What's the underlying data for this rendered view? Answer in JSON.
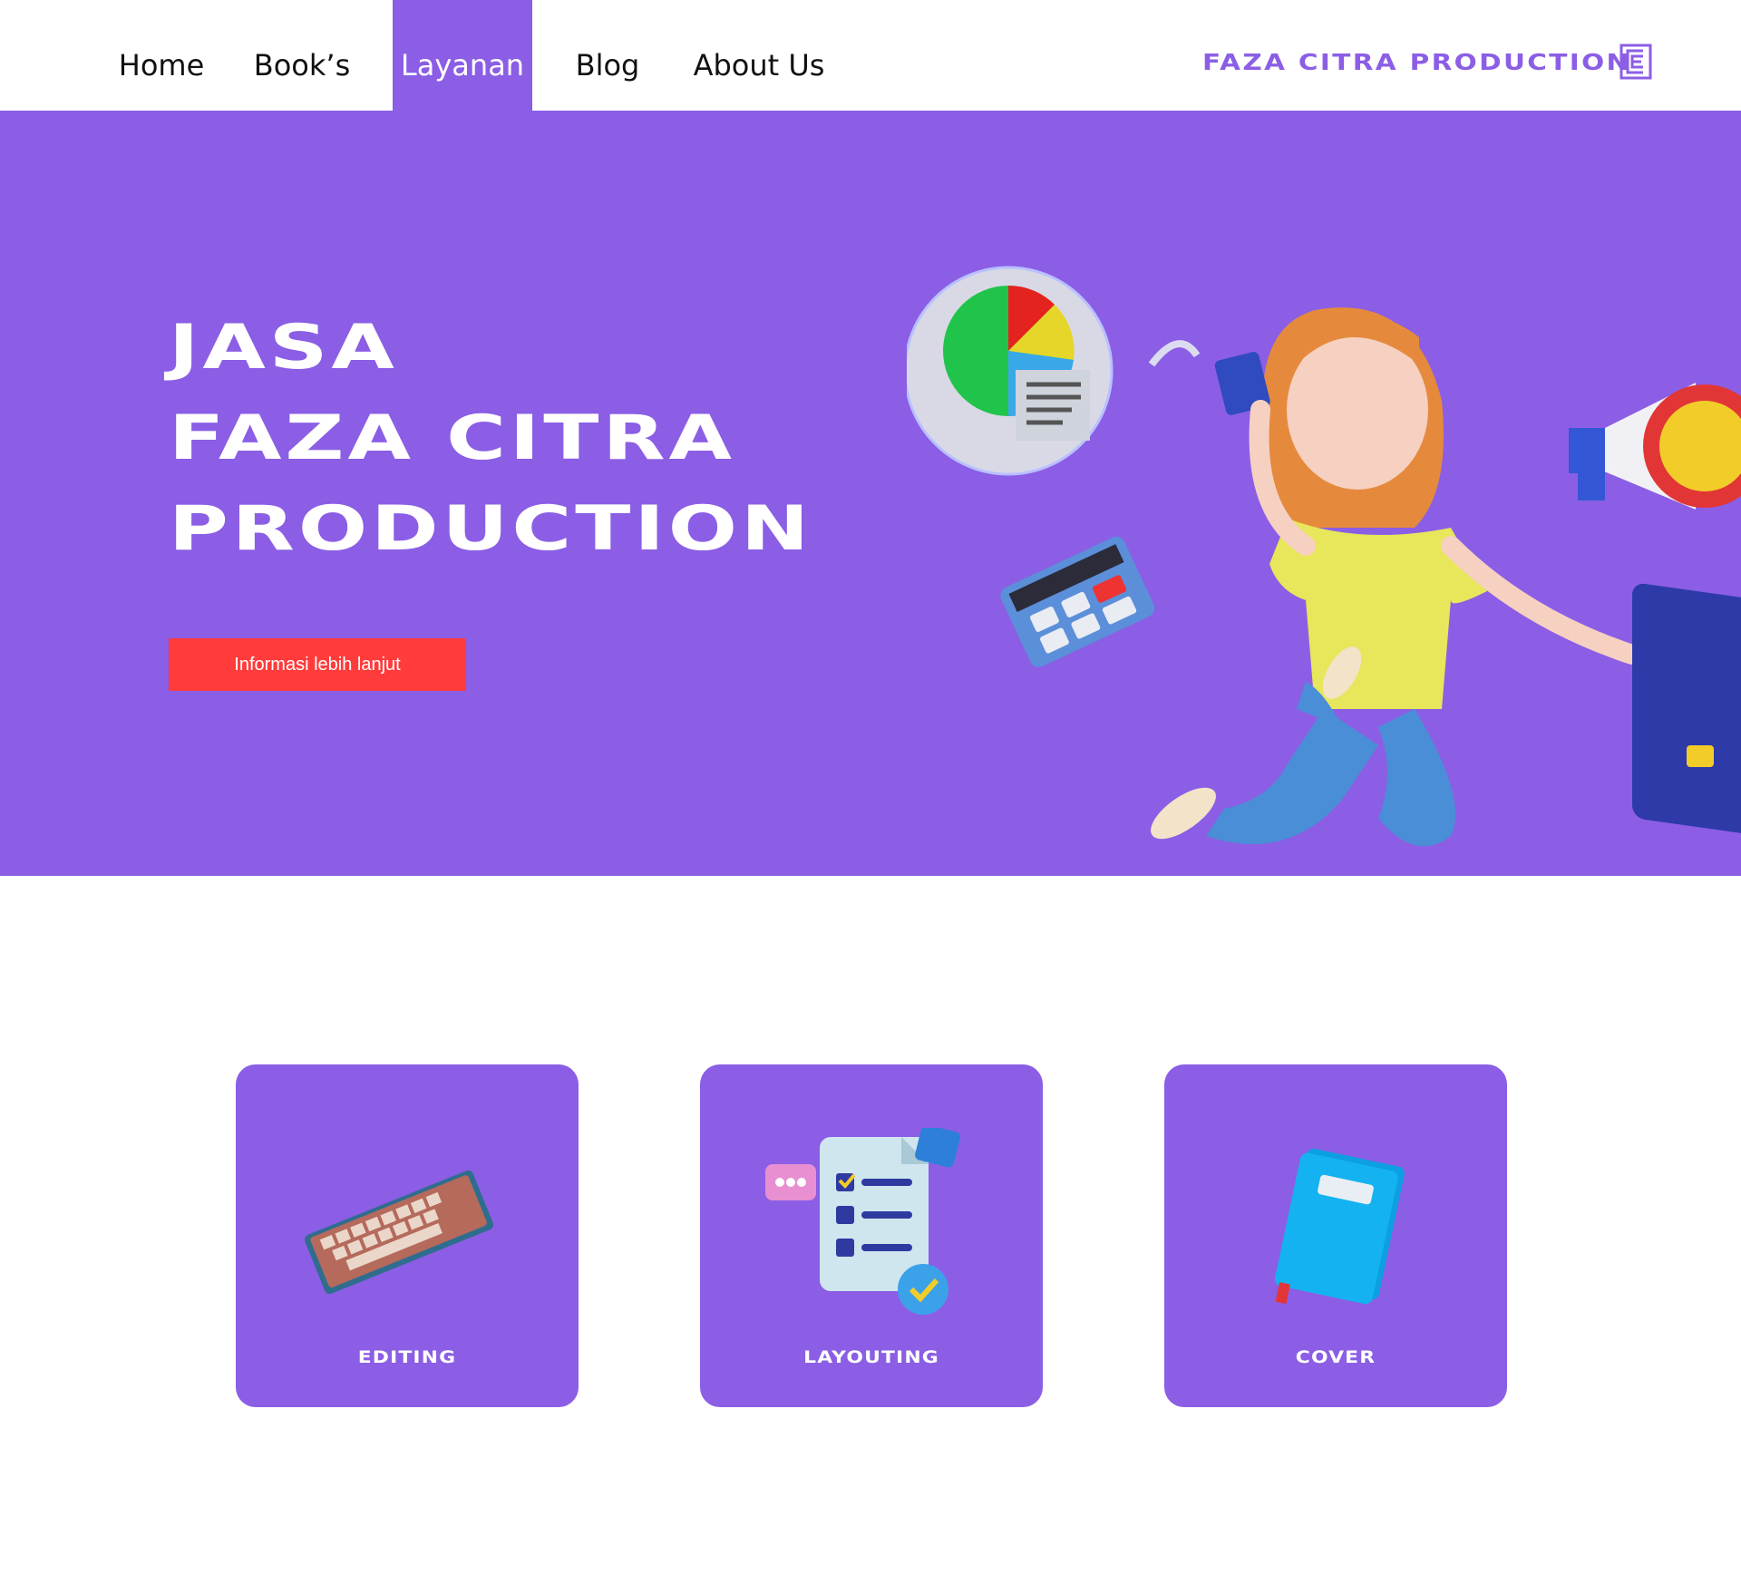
{
  "nav": {
    "items": [
      {
        "label": "Home"
      },
      {
        "label": "Book’s"
      },
      {
        "label": "Layanan"
      },
      {
        "label": "Blog"
      },
      {
        "label": "About Us"
      }
    ],
    "active_index": 2,
    "brand": "FAZA CITRA PRODUCTION",
    "brand_icon": "fc-logo-icon"
  },
  "hero": {
    "title_lines": [
      "JASA",
      "FAZA CITRA",
      "PRODUCTION"
    ],
    "cta_label": "Informasi lebih lanjut",
    "illustration": "girl-jumping-with-phone-illustration"
  },
  "services": [
    {
      "label": "EDITING",
      "icon": "keyboard-icon"
    },
    {
      "label": "LAYOUTING",
      "icon": "checklist-document-icon"
    },
    {
      "label": "COVER",
      "icon": "book-icon"
    }
  ],
  "colors": {
    "primary": "#8b5ee5",
    "cta": "#ff3b3b",
    "background": "#ffffff"
  }
}
